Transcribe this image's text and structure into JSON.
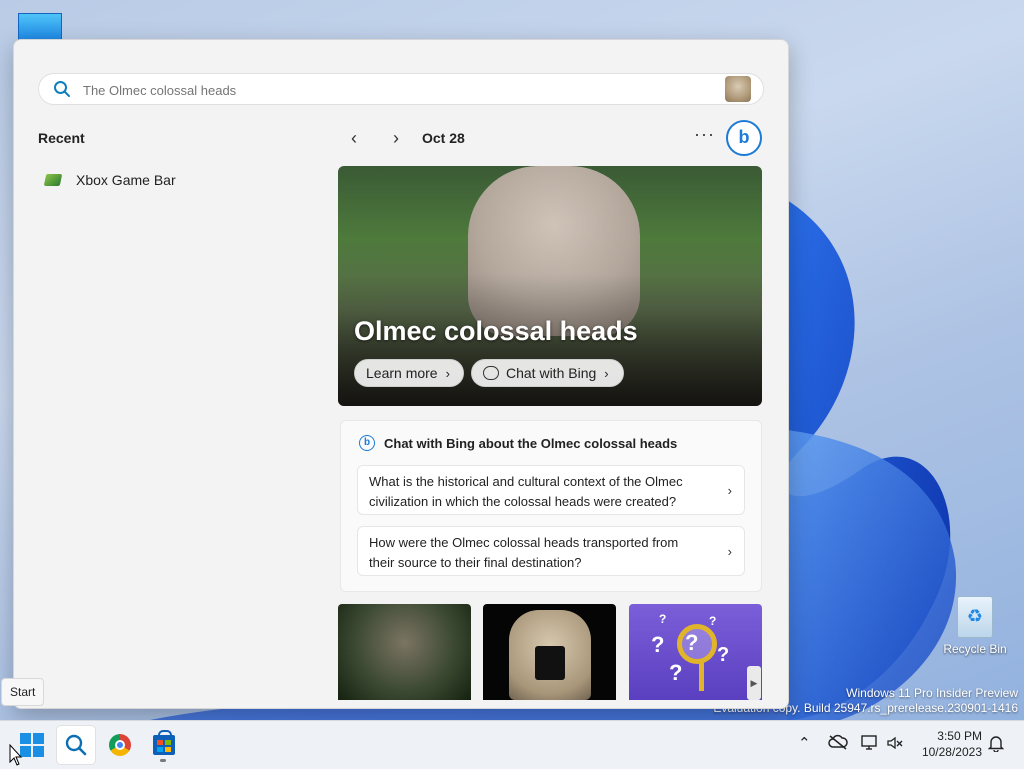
{
  "panel": {
    "search_placeholder": "The Olmec colossal heads",
    "recent_heading": "Recent",
    "recent_items": [
      {
        "label": "Xbox Game Bar"
      }
    ],
    "nav": {
      "date": "Oct 28",
      "more": "···"
    },
    "hero": {
      "title": "Olmec colossal heads",
      "learn_more": "Learn more",
      "chat_with_bing": "Chat with Bing"
    },
    "chat_card": {
      "heading": "Chat with Bing about the Olmec colossal heads",
      "questions": [
        "What is the historical and cultural context of the Olmec civilization in which the colossal heads were created?",
        "How were the Olmec colossal heads transported from their source to their final destination?"
      ]
    }
  },
  "desktop": {
    "recycle_bin": "Recycle Bin",
    "watermark_line1": "Windows 11 Pro Insider Preview",
    "watermark_line2": "Evaluation copy. Build 25947.rs_prerelease.230901-1416"
  },
  "tooltip": "Start",
  "taskbar": {
    "time": "3:50 PM",
    "date": "10/28/2023"
  },
  "colors": {
    "accent": "#1a8fe3",
    "bing": "#1b7bd6"
  }
}
